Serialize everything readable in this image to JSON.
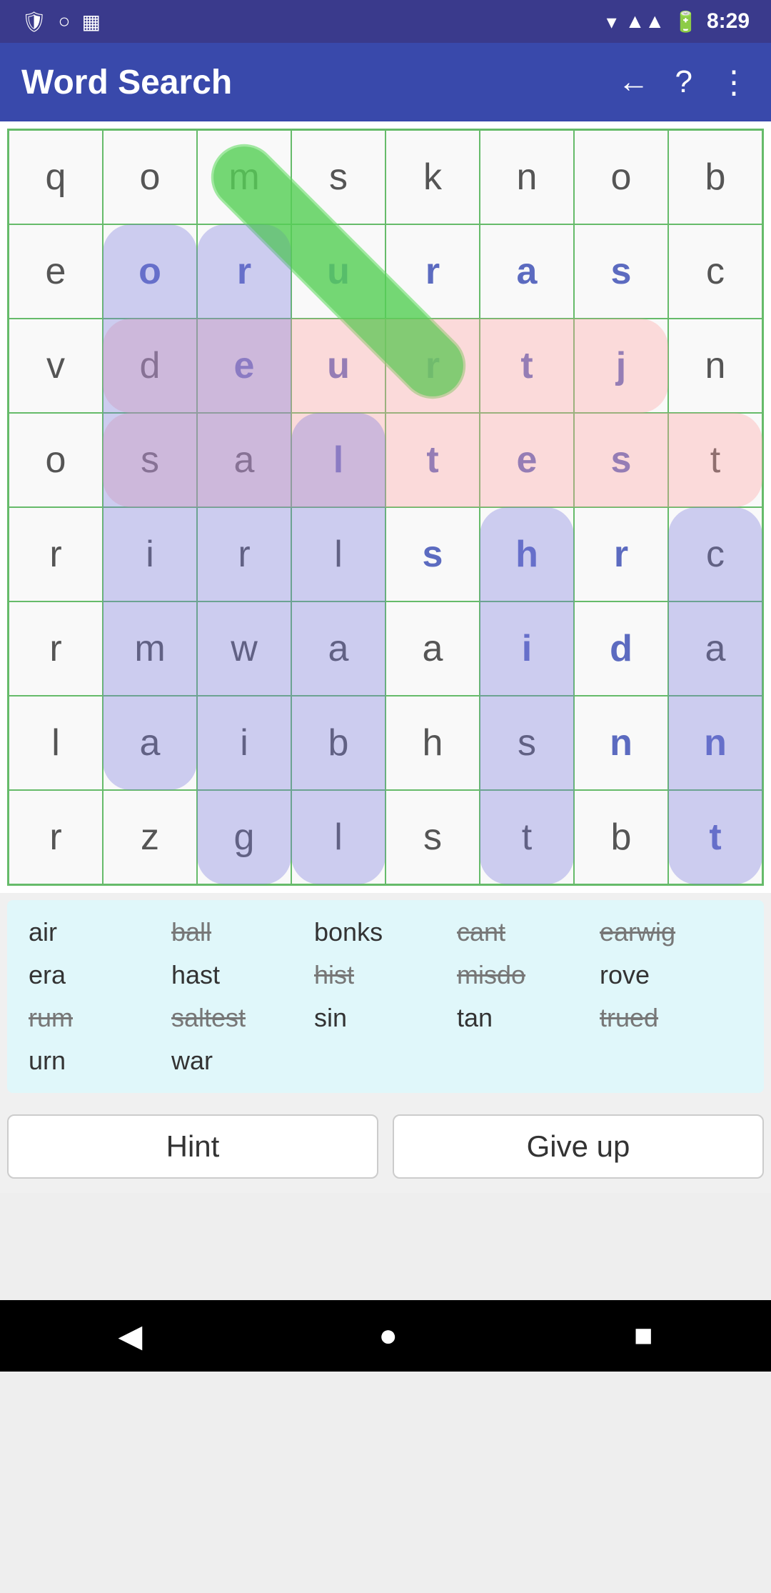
{
  "status_bar": {
    "time": "8:29",
    "icons": [
      "shield",
      "circle",
      "sim"
    ]
  },
  "app_bar": {
    "title": "Word Search",
    "back_label": "←",
    "help_label": "?",
    "menu_label": "⋮"
  },
  "grid": {
    "rows": 8,
    "cols": 8,
    "cells": [
      [
        "q",
        "o",
        "m",
        "s",
        "k",
        "n",
        "o",
        "b"
      ],
      [
        "e",
        "o",
        "r",
        "u",
        "r",
        "a",
        "s",
        "c"
      ],
      [
        "v",
        "d",
        "e",
        "u",
        "r",
        "t",
        "j",
        "n"
      ],
      [
        "o",
        "s",
        "a",
        "l",
        "t",
        "e",
        "s",
        "t"
      ],
      [
        "r",
        "i",
        "r",
        "l",
        "s",
        "h",
        "r",
        "c"
      ],
      [
        "r",
        "m",
        "w",
        "a",
        "a",
        "i",
        "d",
        "a"
      ],
      [
        "l",
        "a",
        "i",
        "b",
        "h",
        "s",
        "n",
        "n"
      ],
      [
        "r",
        "z",
        "g",
        "l",
        "s",
        "t",
        "b",
        "t"
      ]
    ],
    "highlighted_purple_cells": [
      [
        1,
        1
      ],
      [
        2,
        1
      ],
      [
        3,
        1
      ],
      [
        4,
        1
      ],
      [
        5,
        1
      ],
      [
        6,
        1
      ],
      [
        2,
        2
      ],
      [
        3,
        2
      ],
      [
        4,
        2
      ],
      [
        5,
        2
      ],
      [
        6,
        2
      ],
      [
        3,
        3
      ],
      [
        4,
        3
      ],
      [
        5,
        3
      ],
      [
        6,
        3
      ],
      [
        4,
        4
      ],
      [
        5,
        4
      ],
      [
        6,
        4
      ],
      [
        5,
        5
      ],
      [
        6,
        5
      ],
      [
        6,
        6
      ],
      [
        7,
        6
      ],
      [
        7,
        7
      ]
    ]
  },
  "words": [
    {
      "text": "air",
      "found": false
    },
    {
      "text": "ball",
      "found": true
    },
    {
      "text": "bonks",
      "found": false
    },
    {
      "text": "cant",
      "found": true
    },
    {
      "text": "earwig",
      "found": true
    },
    {
      "text": "era",
      "found": false
    },
    {
      "text": "hast",
      "found": false
    },
    {
      "text": "hist",
      "found": true
    },
    {
      "text": "misdo",
      "found": true
    },
    {
      "text": "rove",
      "found": false
    },
    {
      "text": "rum",
      "found": true
    },
    {
      "text": "saltest",
      "found": true
    },
    {
      "text": "sin",
      "found": false
    },
    {
      "text": "tan",
      "found": false
    },
    {
      "text": "trued",
      "found": true
    },
    {
      "text": "urn",
      "found": false
    },
    {
      "text": "war",
      "found": false
    }
  ],
  "buttons": {
    "hint": "Hint",
    "give_up": "Give up"
  }
}
